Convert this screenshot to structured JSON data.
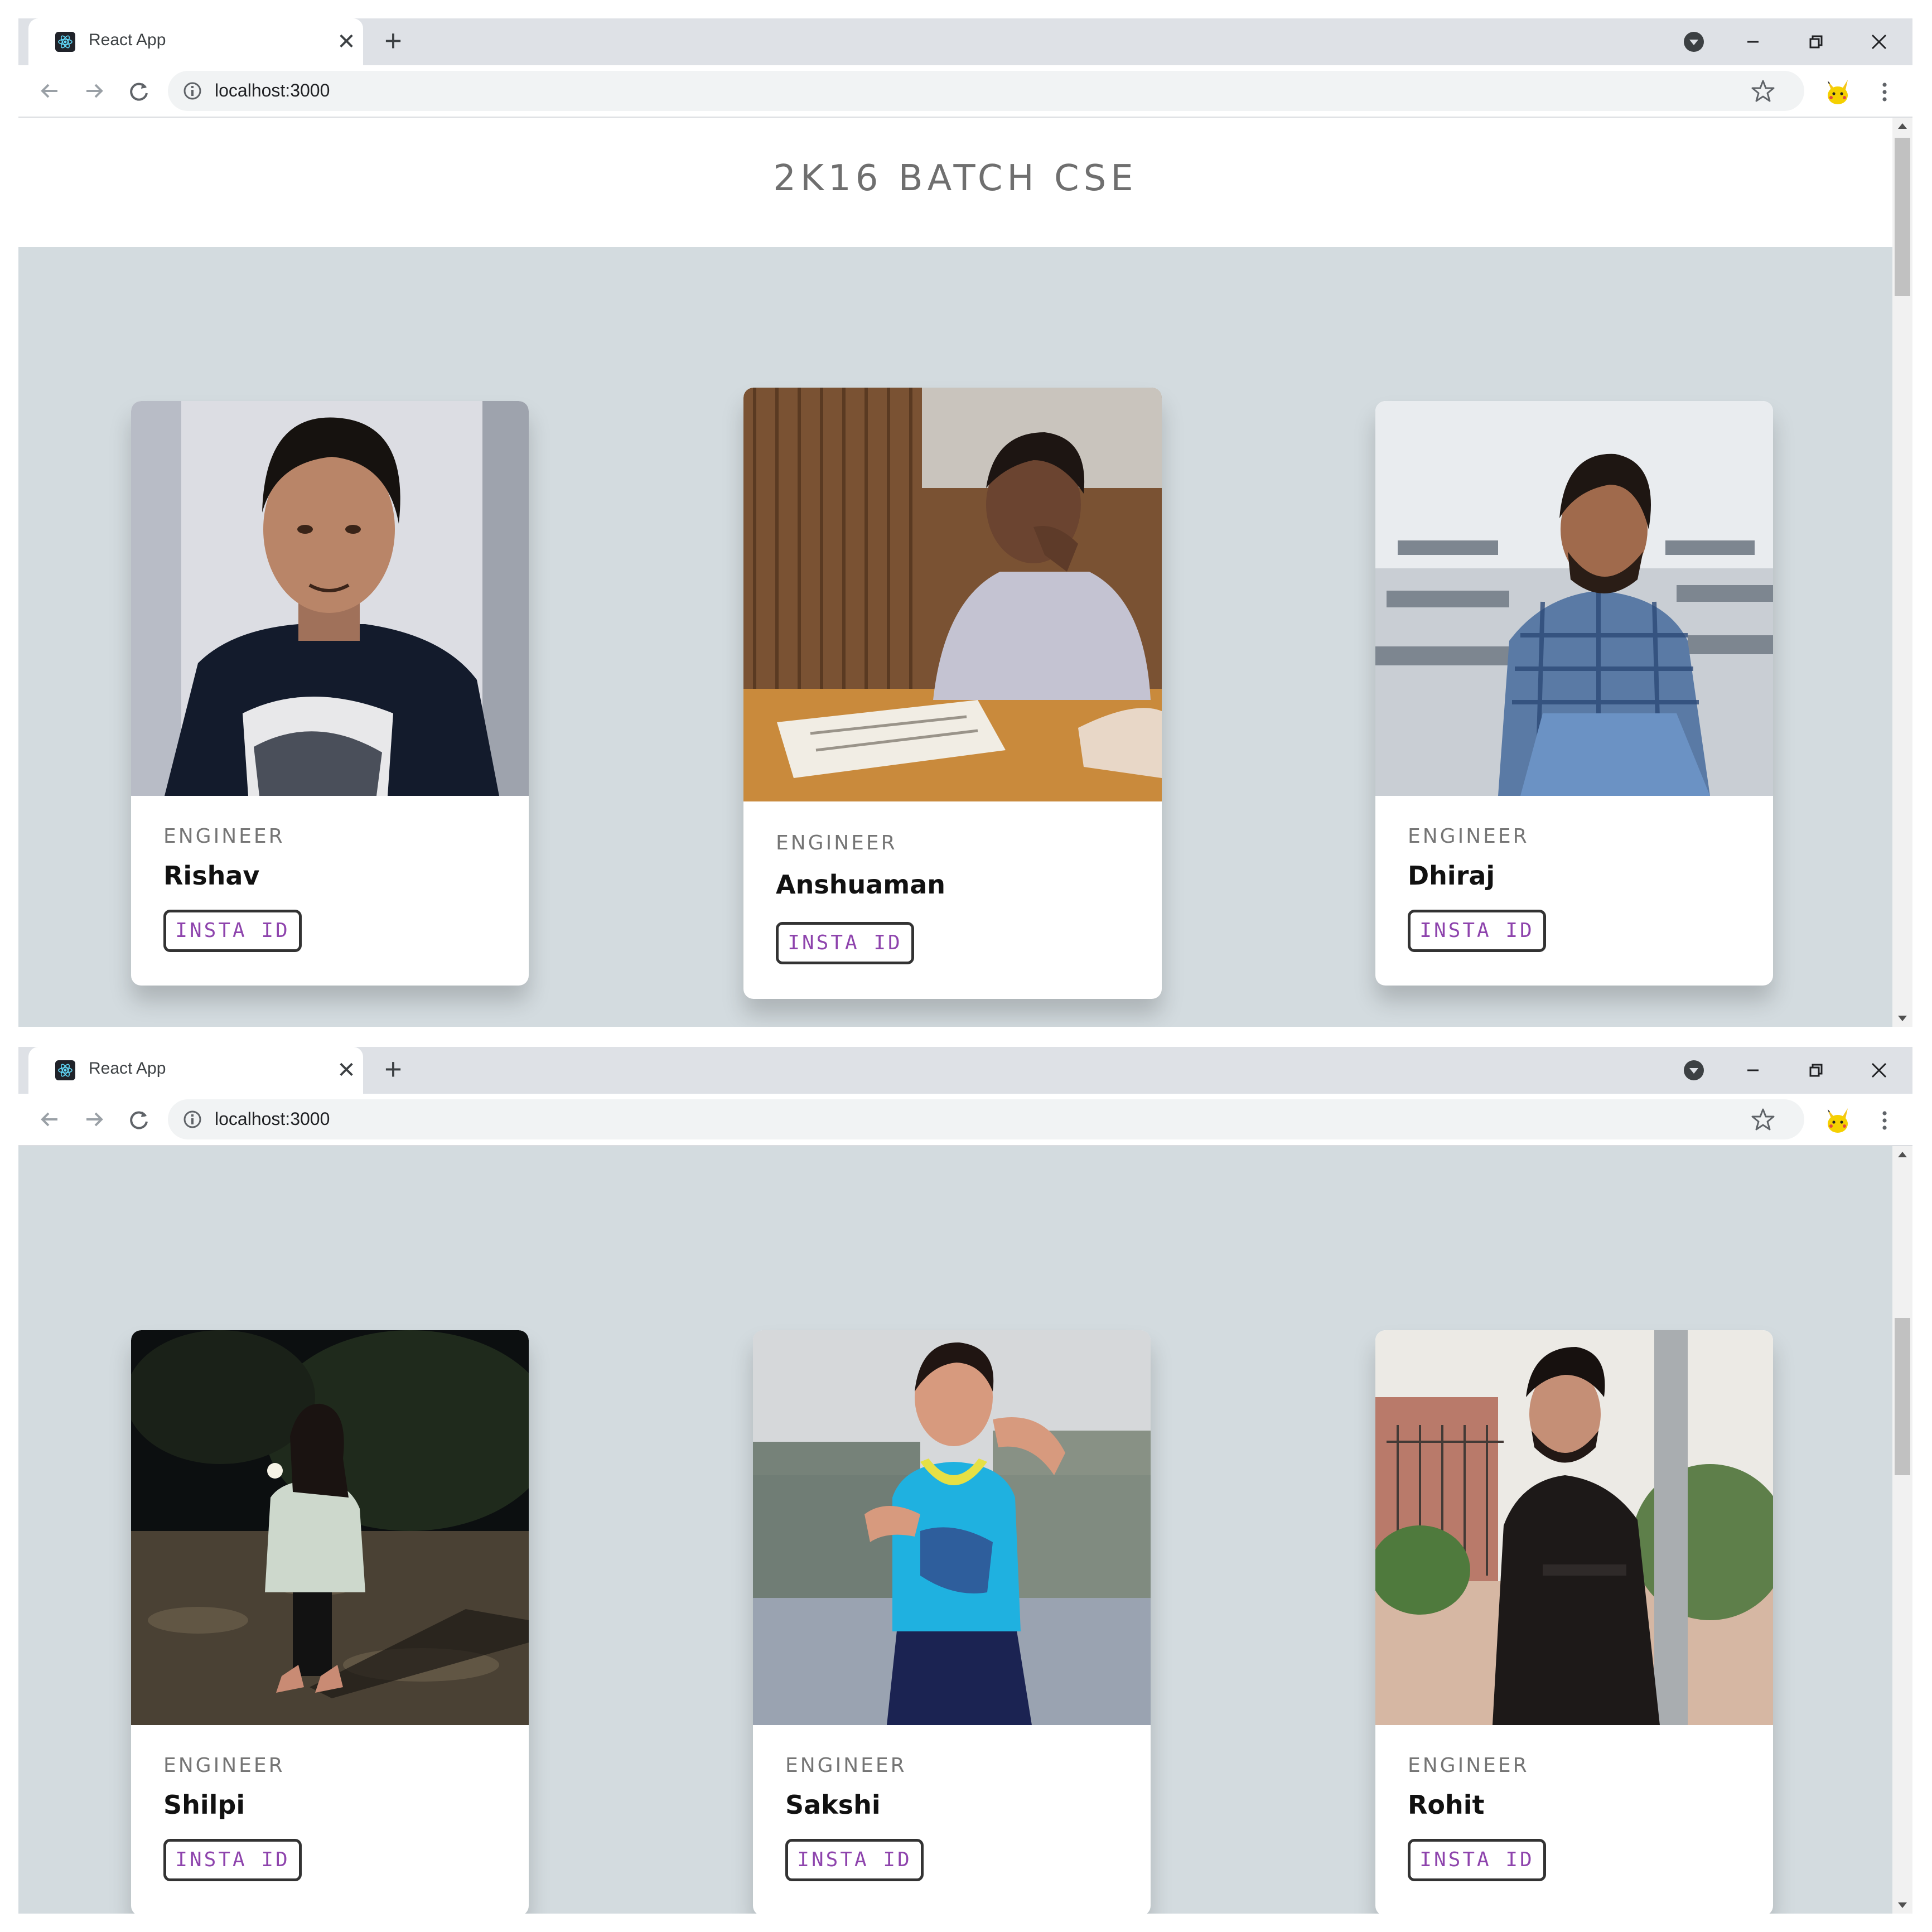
{
  "browser": {
    "tab_title": "React App",
    "tab_close_glyph": "✕",
    "new_tab_glyph": "+",
    "url": "localhost:3000",
    "icons": [
      "react-favicon-icon",
      "close-icon",
      "plus-icon",
      "profile-icon",
      "minimize-icon",
      "restore-icon",
      "close-window-icon",
      "back-icon",
      "forward-icon",
      "reload-icon",
      "info-icon",
      "star-icon",
      "pikachu-extension-icon",
      "menu-icon"
    ]
  },
  "page": {
    "title": "2K16 BATCH CSE",
    "background_color": "#d3dbdf",
    "button_text_color": "#8e44ad"
  },
  "cards": [
    {
      "role": "ENGINEER",
      "name": "Rishav",
      "button": "INSTA ID",
      "photo": "portrait-man-black-tshirt"
    },
    {
      "role": "ENGINEER",
      "name": "Anshuaman",
      "button": "INSTA ID",
      "photo": "man-reading-newspaper"
    },
    {
      "role": "ENGINEER",
      "name": "Dhiraj",
      "button": "INSTA ID",
      "photo": "man-checked-shirt-classroom"
    },
    {
      "role": "ENGINEER",
      "name": "Shilpi",
      "button": "INSTA ID",
      "photo": "woman-white-jacket-night"
    },
    {
      "role": "ENGINEER",
      "name": "Sakshi",
      "button": "INSTA ID",
      "photo": "woman-blue-top-street"
    },
    {
      "role": "ENGINEER",
      "name": "Rohit",
      "button": "INSTA ID",
      "photo": "man-black-shirt-pole"
    }
  ]
}
